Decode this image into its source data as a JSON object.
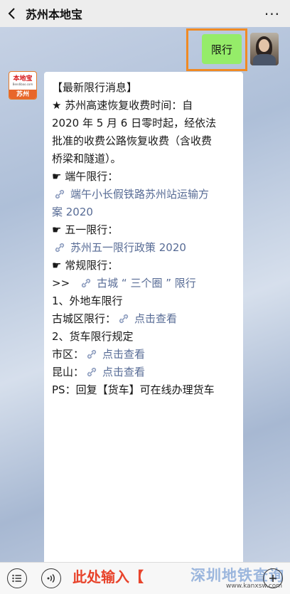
{
  "header": {
    "title": "苏州本地宝",
    "more": "···"
  },
  "outgoing": {
    "text": "限行"
  },
  "bot": {
    "logo_text": "本地宝",
    "logo_url": "Bendibao.com",
    "logo_city": "苏州"
  },
  "message": {
    "heading": "【最新限行消息】",
    "highway_lines": [
      "★ 苏州高速恢复收费时间：自",
      "2020 年 5 月 6 日零时起，经依法",
      "批准的收费公路恢复收费（含收费",
      "桥梁和隧道）。"
    ],
    "dragon_label": "☛ 端午限行：",
    "dragon_link_a": "端午小长假铁路苏州站运输方",
    "dragon_link_b": "案 2020",
    "mayday_label": "☛ 五一限行：",
    "mayday_link": "苏州五一限行政策 2020",
    "regular_label": "☛ 常规限行：",
    "regular_prefix": ">>",
    "regular_link": "古城 “ 三个圈 ” 限行",
    "section1_title": "1、外地车限行",
    "section1_item_label": "古城区限行：",
    "section1_item_link": "点击查看",
    "section2_title": "2、货车限行规定",
    "section2_item1_label": "市区：",
    "section2_item1_link": "点击查看",
    "section2_item2_label": "昆山：",
    "section2_item2_link": "点击查看",
    "ps_line": "PS：回复【货车】可在线办理货车"
  },
  "input_bar": {
    "text": "此处输入【",
    "watermark": "深圳地铁查询",
    "watermark_url": "www.kanxsw.com"
  },
  "colors": {
    "link": "#576b95",
    "bubble_out": "#95ec69",
    "highlight": "#f08a24",
    "input_text": "#e8432b"
  }
}
